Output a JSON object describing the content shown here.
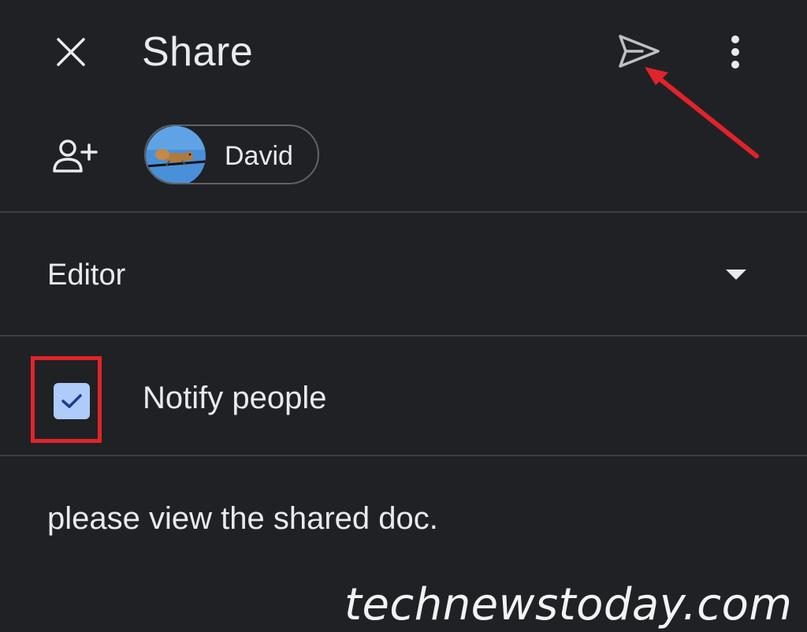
{
  "header": {
    "close_icon": "close-icon",
    "title": "Share",
    "send_icon": "send-icon",
    "more_icon": "more-vert-icon"
  },
  "recipients": {
    "add_icon": "person-add-icon",
    "chips": [
      {
        "name": "David",
        "avatar": "squirrel-photo"
      }
    ]
  },
  "role": {
    "selected": "Editor",
    "dropdown_icon": "arrow-drop-down-icon"
  },
  "notify": {
    "label": "Notify people",
    "checked": true
  },
  "message": {
    "value": "please view the shared doc."
  },
  "annotations": {
    "color": "#e0242a"
  },
  "watermark": "technewstoday.com",
  "colors": {
    "background": "#202124",
    "text": "#e8eaed",
    "checkbox_fill": "#aecbfa",
    "checkmark": "#1f3a93",
    "divider": "#3c4043"
  }
}
